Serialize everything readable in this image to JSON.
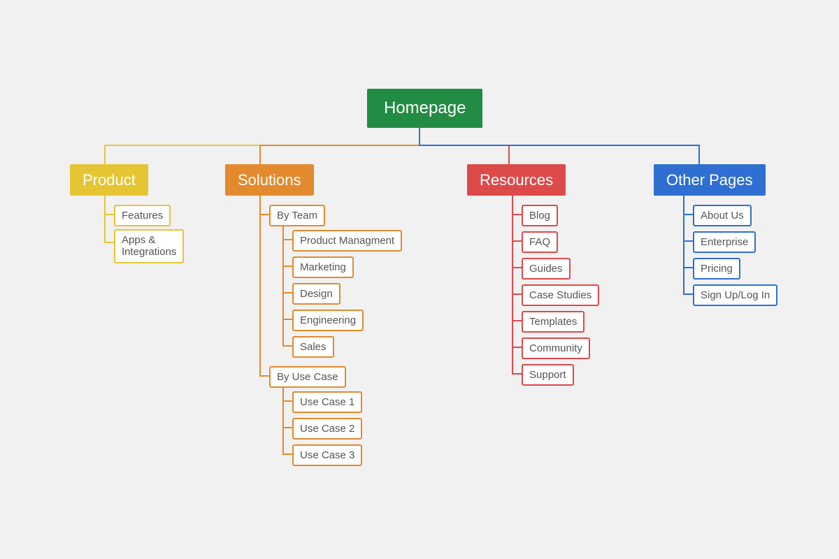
{
  "root": {
    "label": "Homepage"
  },
  "sections": {
    "product": {
      "label": "Product",
      "color": "#e6c535"
    },
    "solutions": {
      "label": "Solutions",
      "color": "#e38a2f"
    },
    "resources": {
      "label": "Resources",
      "color": "#dd4a4a"
    },
    "other": {
      "label": "Other Pages",
      "color": "#2f6fd2"
    }
  },
  "product_children": [
    {
      "label": "Features"
    },
    {
      "label": "Apps & Integrations"
    }
  ],
  "solutions_groups": [
    {
      "label": "By Team",
      "children": [
        {
          "label": "Product Managment"
        },
        {
          "label": "Marketing"
        },
        {
          "label": "Design"
        },
        {
          "label": "Engineering"
        },
        {
          "label": "Sales"
        }
      ]
    },
    {
      "label": "By Use Case",
      "children": [
        {
          "label": "Use Case 1"
        },
        {
          "label": "Use Case 2"
        },
        {
          "label": "Use Case 3"
        }
      ]
    }
  ],
  "resources_children": [
    {
      "label": "Blog"
    },
    {
      "label": "FAQ"
    },
    {
      "label": "Guides"
    },
    {
      "label": "Case Studies"
    },
    {
      "label": "Templates"
    },
    {
      "label": "Community"
    },
    {
      "label": "Support"
    }
  ],
  "other_children": [
    {
      "label": "About Us"
    },
    {
      "label": "Enterprise"
    },
    {
      "label": "Pricing"
    },
    {
      "label": "Sign Up/Log In"
    }
  ]
}
